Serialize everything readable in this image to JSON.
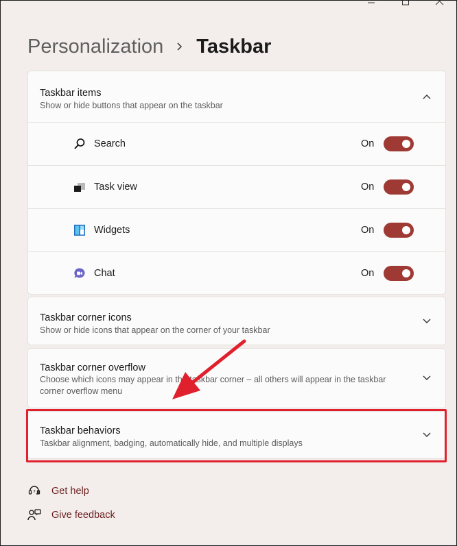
{
  "window_controls": [
    "minimize",
    "maximize",
    "close"
  ],
  "breadcrumb": {
    "parent": "Personalization",
    "current": "Taskbar"
  },
  "taskbar_items": {
    "title": "Taskbar items",
    "description": "Show or hide buttons that appear on the taskbar",
    "expanded": true,
    "items": [
      {
        "label": "Search",
        "state": "On",
        "icon": "search-icon"
      },
      {
        "label": "Task view",
        "state": "On",
        "icon": "task-view-icon"
      },
      {
        "label": "Widgets",
        "state": "On",
        "icon": "widgets-icon"
      },
      {
        "label": "Chat",
        "state": "On",
        "icon": "chat-icon"
      }
    ]
  },
  "corner_icons": {
    "title": "Taskbar corner icons",
    "description": "Show or hide icons that appear on the corner of your taskbar"
  },
  "corner_overflow": {
    "title": "Taskbar corner overflow",
    "description": "Choose which icons may appear in the taskbar corner – all others will appear in the taskbar corner overflow menu"
  },
  "behaviors": {
    "title": "Taskbar behaviors",
    "description": "Taskbar alignment, badging, automatically hide, and multiple displays"
  },
  "links": {
    "help": "Get help",
    "feedback": "Give feedback"
  },
  "colors": {
    "toggle_on": "#9e3a33",
    "highlight": "#e0202c",
    "link": "#6b2020"
  }
}
